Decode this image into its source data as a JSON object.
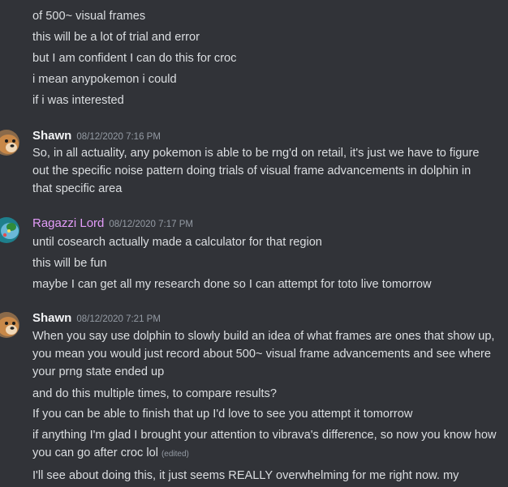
{
  "top_messages": [
    "of 500~ visual frames",
    "this will be a lot of trial and error",
    "but I am confident I can do this for croc",
    "i mean anypokemon i could",
    "if i was interested"
  ],
  "msg1": {
    "author": "Shawn",
    "timestamp": "08/12/2020 7:16 PM",
    "lines": [
      "So, in all actuality, any pokemon is able to be rng'd on retail, it's just we have to figure out the specific noise pattern doing trials of visual frame advancements in dolphin in that specific area"
    ]
  },
  "msg2": {
    "author": "Ragazzi Lord",
    "timestamp": "08/12/2020 7:17 PM",
    "lines": [
      "until cosearch actually made a calculator for that region",
      "this will be fun",
      "maybe I can get all my research done so I can attempt for toto live tomorrow"
    ]
  },
  "msg3": {
    "author": "Shawn",
    "timestamp": "08/12/2020 7:21 PM",
    "lines": [
      "When you say use dolphin to slowly build an idea of what frames are ones that show up, you mean you would just record about 500~ visual frame advancements and see where your prng state ended up",
      "and do this multiple times, to compare results?",
      "If you can be able to finish that up I'd love to see you attempt it tomorrow",
      "if anything I'm glad I brought your attention to vibrava's difference, so now you know how you can go after croc lol",
      "I'll see about doing this, it just seems REALLY overwhelming for me right now. my"
    ],
    "edited_label": "(edited)"
  },
  "colors": {
    "background": "#313338",
    "text": "#dbdee1",
    "shawn_name": "#f2f3f5",
    "ragazzi_name": "#e39cf9",
    "timestamp": "#949ba4"
  }
}
